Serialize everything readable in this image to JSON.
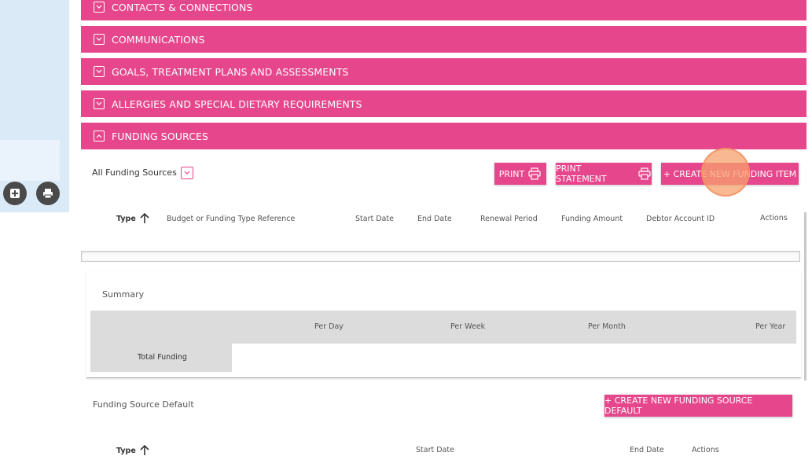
{
  "accordions": [
    {
      "label": "CONTACTS & CONNECTIONS",
      "expanded": false
    },
    {
      "label": "COMMUNICATIONS",
      "expanded": false
    },
    {
      "label": "GOALS, TREATMENT PLANS AND ASSESSMENTS",
      "expanded": false
    },
    {
      "label": "ALLERGIES AND SPECIAL DIETARY REQUIREMENTS",
      "expanded": false
    },
    {
      "label": "FUNDING SOURCES",
      "expanded": true
    }
  ],
  "funding": {
    "filter_label": "All Funding Sources",
    "print_label": "PRINT",
    "print_statement_label": "PRINT STATEMENT",
    "create_label": "+ CREATE NEW FUNDING ITEM",
    "columns": [
      "Type",
      "Budget or Funding Type Reference",
      "Start Date",
      "End Date",
      "Renewal Period",
      "Funding Amount",
      "Debtor Account ID",
      "Actions"
    ]
  },
  "summary": {
    "title": "Summary",
    "columns": [
      "Per Day",
      "Per Week",
      "Per Month",
      "Per Year"
    ],
    "row_label": "Total Funding"
  },
  "defaults": {
    "title": "Funding Source Default",
    "create_label": "+ CREATE NEW FUNDING SOURCE DEFAULT",
    "columns": [
      "Type",
      "Start Date",
      "End Date",
      "Actions"
    ]
  },
  "colors": {
    "accent": "#e6478c",
    "panel": "#dbeaf7",
    "header_gray": "#dcdcdc"
  },
  "icons": {
    "left_add": "add-note-icon",
    "left_print": "printer-icon",
    "sort": "arrow-up-icon"
  }
}
